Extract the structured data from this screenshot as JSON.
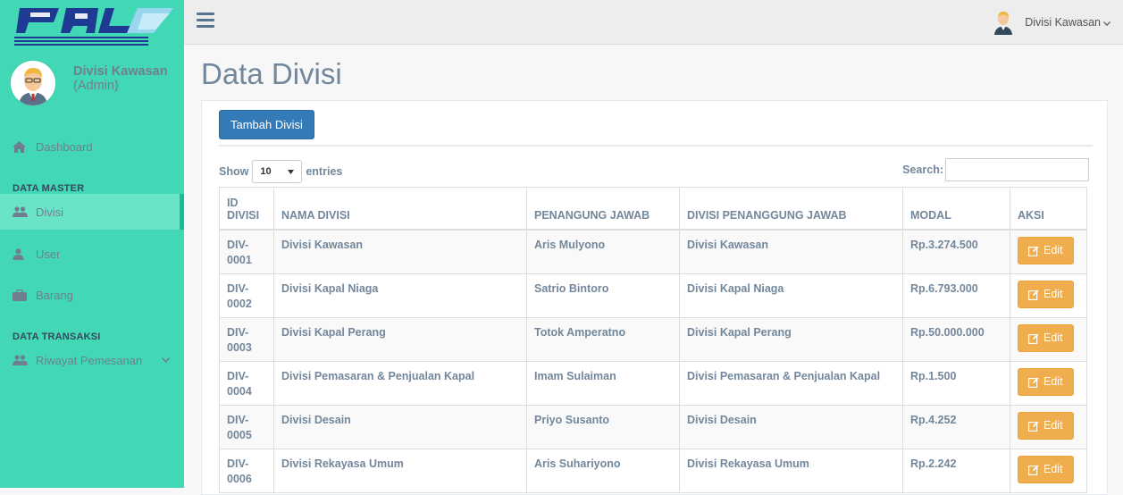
{
  "sidebar": {
    "logo_text": "PAL",
    "profile": {
      "name": "Divisi Kawasan",
      "role": "(Admin)"
    },
    "items": [
      {
        "label": "Dashboard",
        "icon": "home-icon"
      },
      {
        "label": "Divisi",
        "icon": "users-icon"
      },
      {
        "label": "User",
        "icon": "user-icon"
      },
      {
        "label": "Barang",
        "icon": "briefcase-icon"
      },
      {
        "label": "Riwayat Pemesanan",
        "icon": "users-icon"
      }
    ],
    "sections": [
      "DATA MASTER",
      "DATA TRANSAKSI"
    ]
  },
  "topbar": {
    "user": "Divisi Kawasan"
  },
  "main": {
    "title": "Data Divisi",
    "add_button": "Tambah Divisi",
    "show_label": "Show",
    "entries_value": "10",
    "entries_label": "entries",
    "search_label": "Search:",
    "search_value": ""
  },
  "table": {
    "headers": [
      "ID DIVISI",
      "NAMA DIVISI",
      "PENANGUNG JAWAB",
      "DIVISI PENANGGUNG JAWAB",
      "MODAL",
      "AKSI"
    ],
    "edit_label": "Edit",
    "rows": [
      {
        "id": "DIV-0001",
        "nama": "Divisi Kawasan",
        "pj": "Aris Mulyono",
        "divisi_pj": "Divisi Kawasan",
        "modal": "Rp.3.274.500"
      },
      {
        "id": "DIV-0002",
        "nama": "Divisi Kapal Niaga",
        "pj": "Satrio Bintoro",
        "divisi_pj": "Divisi Kapal Niaga",
        "modal": "Rp.6.793.000"
      },
      {
        "id": "DIV-0003",
        "nama": "Divisi Kapal Perang",
        "pj": "Totok Amperatno",
        "divisi_pj": "Divisi Kapal Perang",
        "modal": "Rp.50.000.000"
      },
      {
        "id": "DIV-0004",
        "nama": "Divisi Pemasaran & Penjualan Kapal",
        "pj": "Imam Sulaiman",
        "divisi_pj": "Divisi Pemasaran & Penjualan Kapal",
        "modal": "Rp.1.500"
      },
      {
        "id": "DIV-0005",
        "nama": "Divisi Desain",
        "pj": "Priyo Susanto",
        "divisi_pj": "Divisi Desain",
        "modal": "Rp.4.252"
      },
      {
        "id": "DIV-0006",
        "nama": "Divisi Rekayasa Umum",
        "pj": "Aris Suhariyono",
        "divisi_pj": "Divisi Rekayasa Umum",
        "modal": "Rp.2.242"
      }
    ]
  }
}
